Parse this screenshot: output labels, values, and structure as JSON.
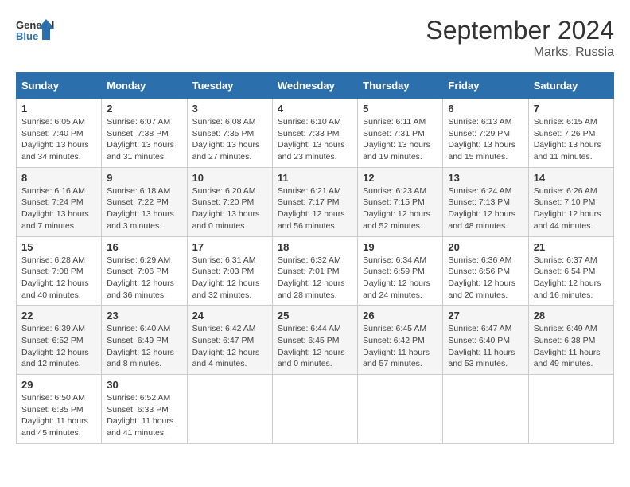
{
  "header": {
    "logo_line1": "General",
    "logo_line2": "Blue",
    "month": "September 2024",
    "location": "Marks, Russia"
  },
  "weekdays": [
    "Sunday",
    "Monday",
    "Tuesday",
    "Wednesday",
    "Thursday",
    "Friday",
    "Saturday"
  ],
  "weeks": [
    [
      {
        "day": "1",
        "sunrise": "6:05 AM",
        "sunset": "7:40 PM",
        "daylight": "13 hours and 34 minutes."
      },
      {
        "day": "2",
        "sunrise": "6:07 AM",
        "sunset": "7:38 PM",
        "daylight": "13 hours and 31 minutes."
      },
      {
        "day": "3",
        "sunrise": "6:08 AM",
        "sunset": "7:35 PM",
        "daylight": "13 hours and 27 minutes."
      },
      {
        "day": "4",
        "sunrise": "6:10 AM",
        "sunset": "7:33 PM",
        "daylight": "13 hours and 23 minutes."
      },
      {
        "day": "5",
        "sunrise": "6:11 AM",
        "sunset": "7:31 PM",
        "daylight": "13 hours and 19 minutes."
      },
      {
        "day": "6",
        "sunrise": "6:13 AM",
        "sunset": "7:29 PM",
        "daylight": "13 hours and 15 minutes."
      },
      {
        "day": "7",
        "sunrise": "6:15 AM",
        "sunset": "7:26 PM",
        "daylight": "13 hours and 11 minutes."
      }
    ],
    [
      {
        "day": "8",
        "sunrise": "6:16 AM",
        "sunset": "7:24 PM",
        "daylight": "13 hours and 7 minutes."
      },
      {
        "day": "9",
        "sunrise": "6:18 AM",
        "sunset": "7:22 PM",
        "daylight": "13 hours and 3 minutes."
      },
      {
        "day": "10",
        "sunrise": "6:20 AM",
        "sunset": "7:20 PM",
        "daylight": "13 hours and 0 minutes."
      },
      {
        "day": "11",
        "sunrise": "6:21 AM",
        "sunset": "7:17 PM",
        "daylight": "12 hours and 56 minutes."
      },
      {
        "day": "12",
        "sunrise": "6:23 AM",
        "sunset": "7:15 PM",
        "daylight": "12 hours and 52 minutes."
      },
      {
        "day": "13",
        "sunrise": "6:24 AM",
        "sunset": "7:13 PM",
        "daylight": "12 hours and 48 minutes."
      },
      {
        "day": "14",
        "sunrise": "6:26 AM",
        "sunset": "7:10 PM",
        "daylight": "12 hours and 44 minutes."
      }
    ],
    [
      {
        "day": "15",
        "sunrise": "6:28 AM",
        "sunset": "7:08 PM",
        "daylight": "12 hours and 40 minutes."
      },
      {
        "day": "16",
        "sunrise": "6:29 AM",
        "sunset": "7:06 PM",
        "daylight": "12 hours and 36 minutes."
      },
      {
        "day": "17",
        "sunrise": "6:31 AM",
        "sunset": "7:03 PM",
        "daylight": "12 hours and 32 minutes."
      },
      {
        "day": "18",
        "sunrise": "6:32 AM",
        "sunset": "7:01 PM",
        "daylight": "12 hours and 28 minutes."
      },
      {
        "day": "19",
        "sunrise": "6:34 AM",
        "sunset": "6:59 PM",
        "daylight": "12 hours and 24 minutes."
      },
      {
        "day": "20",
        "sunrise": "6:36 AM",
        "sunset": "6:56 PM",
        "daylight": "12 hours and 20 minutes."
      },
      {
        "day": "21",
        "sunrise": "6:37 AM",
        "sunset": "6:54 PM",
        "daylight": "12 hours and 16 minutes."
      }
    ],
    [
      {
        "day": "22",
        "sunrise": "6:39 AM",
        "sunset": "6:52 PM",
        "daylight": "12 hours and 12 minutes."
      },
      {
        "day": "23",
        "sunrise": "6:40 AM",
        "sunset": "6:49 PM",
        "daylight": "12 hours and 8 minutes."
      },
      {
        "day": "24",
        "sunrise": "6:42 AM",
        "sunset": "6:47 PM",
        "daylight": "12 hours and 4 minutes."
      },
      {
        "day": "25",
        "sunrise": "6:44 AM",
        "sunset": "6:45 PM",
        "daylight": "12 hours and 0 minutes."
      },
      {
        "day": "26",
        "sunrise": "6:45 AM",
        "sunset": "6:42 PM",
        "daylight": "11 hours and 57 minutes."
      },
      {
        "day": "27",
        "sunrise": "6:47 AM",
        "sunset": "6:40 PM",
        "daylight": "11 hours and 53 minutes."
      },
      {
        "day": "28",
        "sunrise": "6:49 AM",
        "sunset": "6:38 PM",
        "daylight": "11 hours and 49 minutes."
      }
    ],
    [
      {
        "day": "29",
        "sunrise": "6:50 AM",
        "sunset": "6:35 PM",
        "daylight": "11 hours and 45 minutes."
      },
      {
        "day": "30",
        "sunrise": "6:52 AM",
        "sunset": "6:33 PM",
        "daylight": "11 hours and 41 minutes."
      },
      null,
      null,
      null,
      null,
      null
    ]
  ]
}
